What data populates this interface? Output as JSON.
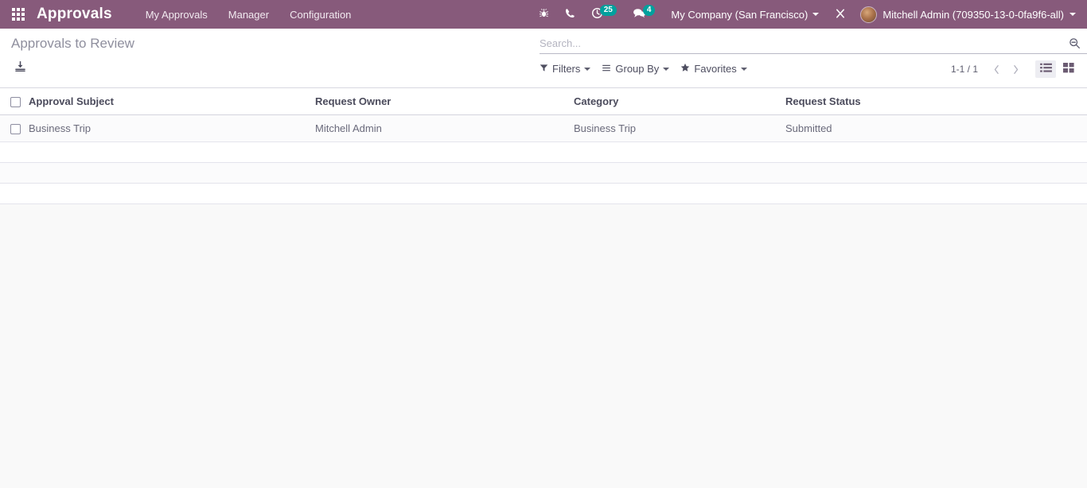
{
  "navbar": {
    "apps_icon": "apps-grid-icon",
    "brand": "Approvals",
    "menu_items": [
      {
        "label": "My Approvals",
        "name": "menu-my-approvals"
      },
      {
        "label": "Manager",
        "name": "menu-manager"
      },
      {
        "label": "Configuration",
        "name": "menu-configuration"
      }
    ],
    "systray": {
      "debug_icon": "bug-icon",
      "phone_icon": "phone-icon",
      "activities_icon": "clock-icon",
      "activities_count": "25",
      "messages_icon": "chat-bubble-icon",
      "messages_count": "4",
      "company": "My Company (San Francisco)",
      "close_icon": "close-x-icon",
      "user": "Mitchell Admin (709350-13-0-0fa9f6-all)",
      "avatar_icon": "user-avatar"
    },
    "colors": {
      "navbar_bg": "#875A7B",
      "badge_bg": "#00A09D",
      "text": "#FFFFFF"
    }
  },
  "control_panel": {
    "breadcrumb": "Approvals to Review",
    "download_icon": "download-import-icon",
    "search": {
      "value": "",
      "placeholder": "Search...",
      "magnifier_icon": "search-icon"
    },
    "dropdowns": [
      {
        "label": "Filters",
        "icon": "filter-funnel-icon",
        "name": "filters-dropdown"
      },
      {
        "label": "Group By",
        "icon": "group-by-lines-icon",
        "name": "group-by-dropdown"
      },
      {
        "label": "Favorites",
        "icon": "star-icon",
        "name": "favorites-dropdown"
      }
    ],
    "pager": {
      "range": "1-1 / 1",
      "prev_icon": "chevron-left-icon",
      "next_icon": "chevron-right-icon"
    },
    "views": [
      {
        "name": "list-view-button",
        "icon": "list-icon",
        "active": true
      },
      {
        "name": "kanban-view-button",
        "icon": "kanban-grid-icon",
        "active": false
      }
    ]
  },
  "list": {
    "columns": [
      "Approval Subject",
      "Request Owner",
      "Category",
      "Request Status"
    ],
    "rows": [
      {
        "subject": "Business Trip",
        "owner": "Mitchell Admin",
        "category": "Business Trip",
        "status": "Submitted"
      }
    ],
    "empty_row_count": 3
  }
}
